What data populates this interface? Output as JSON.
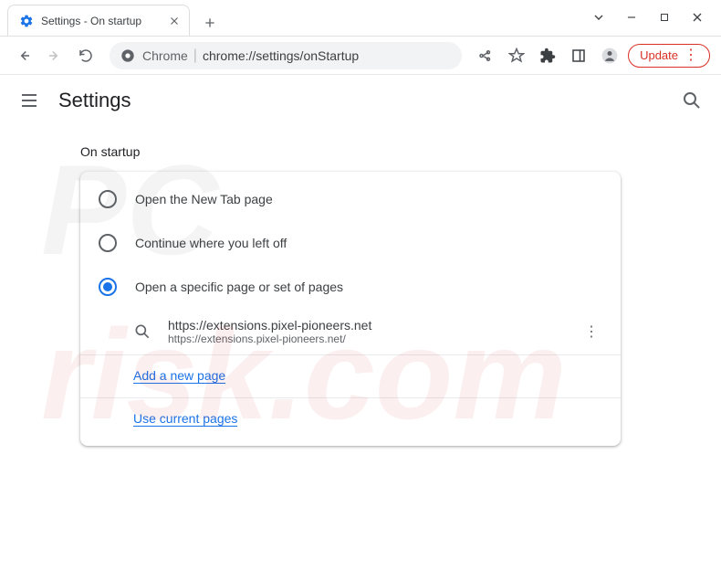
{
  "window": {
    "tab_title": "Settings - On startup"
  },
  "toolbar": {
    "omnibox_prefix": "Chrome",
    "omnibox_path": "chrome://settings/onStartup",
    "update_label": "Update"
  },
  "header": {
    "title": "Settings"
  },
  "section": {
    "title": "On startup",
    "options": [
      {
        "label": "Open the New Tab page",
        "selected": false
      },
      {
        "label": "Continue where you left off",
        "selected": false
      },
      {
        "label": "Open a specific page or set of pages",
        "selected": true
      }
    ],
    "page": {
      "title": "https://extensions.pixel-pioneers.net",
      "url": "https://extensions.pixel-pioneers.net/"
    },
    "add_link": "Add a new page",
    "use_current_link": "Use current pages"
  }
}
